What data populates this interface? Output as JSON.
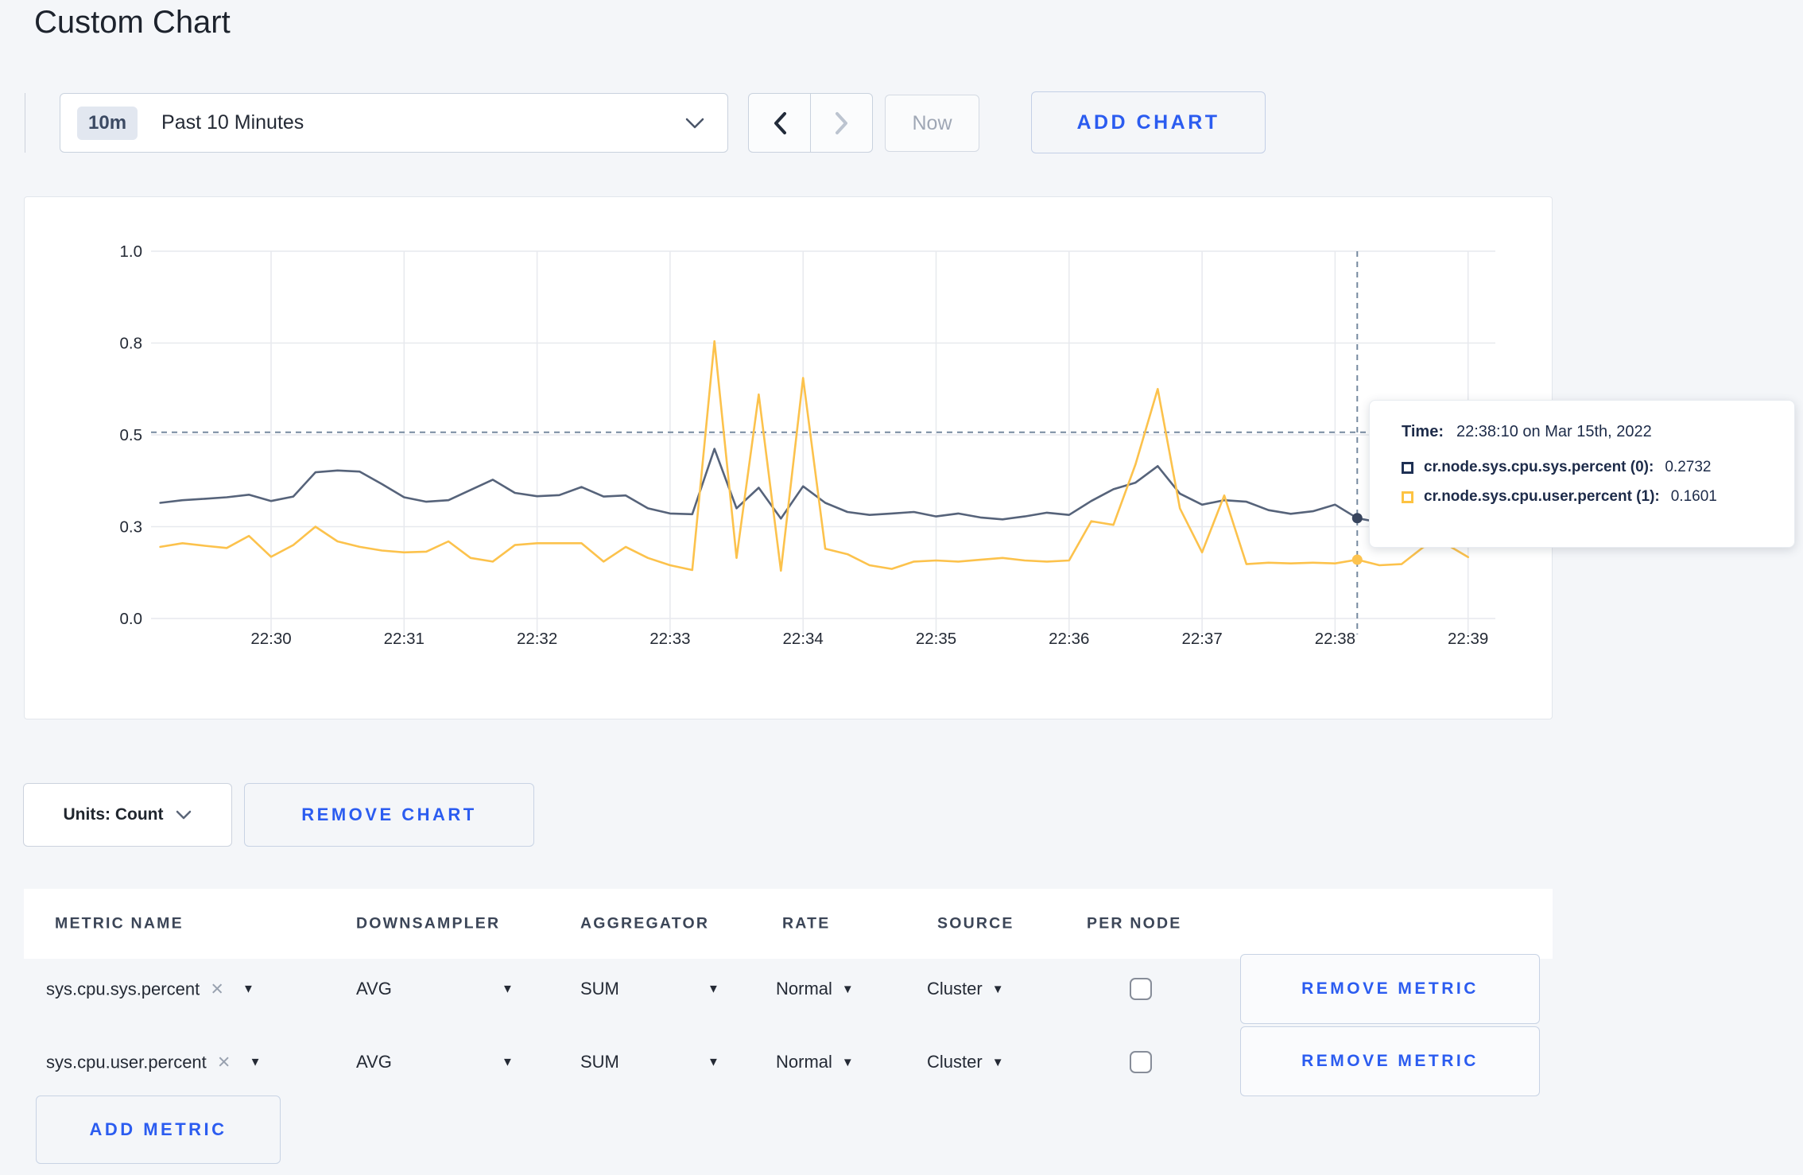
{
  "page": {
    "title": "Custom Chart"
  },
  "toolbar": {
    "time_range": {
      "badge": "10m",
      "label": "Past 10 Minutes"
    },
    "now_label": "Now",
    "add_chart_label": "ADD CHART"
  },
  "icons": {
    "chevron_down": "⌄",
    "chevron_left": "‹",
    "chevron_right": "›",
    "caret_down": "▼",
    "close": "×"
  },
  "chart_controls": {
    "units_label": "Units: Count",
    "remove_chart_label": "REMOVE CHART"
  },
  "metrics_table": {
    "headers": [
      "METRIC NAME",
      "DOWNSAMPLER",
      "AGGREGATOR",
      "RATE",
      "SOURCE",
      "PER NODE"
    ],
    "rows": [
      {
        "name": "sys.cpu.sys.percent",
        "downsampler": "AVG",
        "aggregator": "SUM",
        "rate": "Normal",
        "source": "Cluster",
        "per_node_checked": false
      },
      {
        "name": "sys.cpu.user.percent",
        "downsampler": "AVG",
        "aggregator": "SUM",
        "rate": "Normal",
        "source": "Cluster",
        "per_node_checked": false
      }
    ],
    "remove_metric_label": "REMOVE METRIC",
    "add_metric_label": "ADD METRIC"
  },
  "chart_data": {
    "type": "line",
    "title": "",
    "xlabel": "",
    "ylabel": "",
    "ylim": [
      0,
      1
    ],
    "grid": true,
    "legend_position": "none",
    "x_ticks": [
      "22:30",
      "22:31",
      "22:32",
      "22:33",
      "22:34",
      "22:35",
      "22:36",
      "22:37",
      "22:38",
      "22:39"
    ],
    "y_ticks": [
      {
        "value": 0.0,
        "label": "0.0"
      },
      {
        "value": 0.25,
        "label": "0.3"
      },
      {
        "value": 0.5,
        "label": "0.5"
      },
      {
        "value": 0.75,
        "label": "0.8"
      },
      {
        "value": 1.0,
        "label": "1.0"
      }
    ],
    "x_start_offset_seconds": -50,
    "x_step_seconds": 10,
    "series": [
      {
        "name": "cr.node.sys.cpu.sys.percent (0)",
        "color": "#56637a",
        "values": [
          0.315,
          0.322,
          0.326,
          0.33,
          0.337,
          0.32,
          0.332,
          0.398,
          0.403,
          0.4,
          0.366,
          0.33,
          0.318,
          0.322,
          0.35,
          0.378,
          0.342,
          0.333,
          0.336,
          0.358,
          0.332,
          0.335,
          0.3,
          0.286,
          0.284,
          0.462,
          0.3,
          0.356,
          0.272,
          0.36,
          0.315,
          0.29,
          0.282,
          0.286,
          0.29,
          0.278,
          0.286,
          0.275,
          0.27,
          0.278,
          0.288,
          0.282,
          0.32,
          0.352,
          0.37,
          0.415,
          0.34,
          0.31,
          0.322,
          0.318,
          0.295,
          0.285,
          0.292,
          0.31,
          0.2732,
          0.262,
          0.272,
          0.278,
          0.272,
          0.27
        ]
      },
      {
        "name": "cr.node.sys.cpu.user.percent (1)",
        "color": "#fcc24c",
        "values": [
          0.195,
          0.205,
          0.198,
          0.192,
          0.225,
          0.168,
          0.2,
          0.25,
          0.21,
          0.195,
          0.185,
          0.18,
          0.182,
          0.21,
          0.165,
          0.155,
          0.2,
          0.205,
          0.205,
          0.205,
          0.155,
          0.195,
          0.165,
          0.145,
          0.132,
          0.755,
          0.165,
          0.61,
          0.13,
          0.655,
          0.19,
          0.175,
          0.145,
          0.135,
          0.155,
          0.158,
          0.155,
          0.16,
          0.165,
          0.158,
          0.155,
          0.158,
          0.265,
          0.255,
          0.42,
          0.625,
          0.3,
          0.18,
          0.335,
          0.148,
          0.152,
          0.15,
          0.152,
          0.15,
          0.1601,
          0.145,
          0.148,
          0.195,
          0.203,
          0.167
        ]
      }
    ],
    "crosshair": {
      "time": "22:38:10",
      "x_offset_seconds": 490,
      "h_value": 0.507,
      "points": [
        {
          "series": 0,
          "value": 0.2732,
          "color": "#38455e"
        },
        {
          "series": 1,
          "value": 0.1601,
          "color": "#fdc34f"
        }
      ]
    },
    "tooltip": {
      "time_label": "Time:",
      "time_value": "22:38:10 on Mar 15th, 2022",
      "entries": [
        {
          "name": "cr.node.sys.cpu.sys.percent (0):",
          "value": "0.2732",
          "color": "#1e3054"
        },
        {
          "name": "cr.node.sys.cpu.user.percent (1):",
          "value": "0.1601",
          "color": "#fdc342"
        }
      ]
    },
    "style": {
      "grid_color": "#e7e9ee",
      "axis_label_color": "#242a35",
      "crosshair_color": "#76899f"
    }
  }
}
